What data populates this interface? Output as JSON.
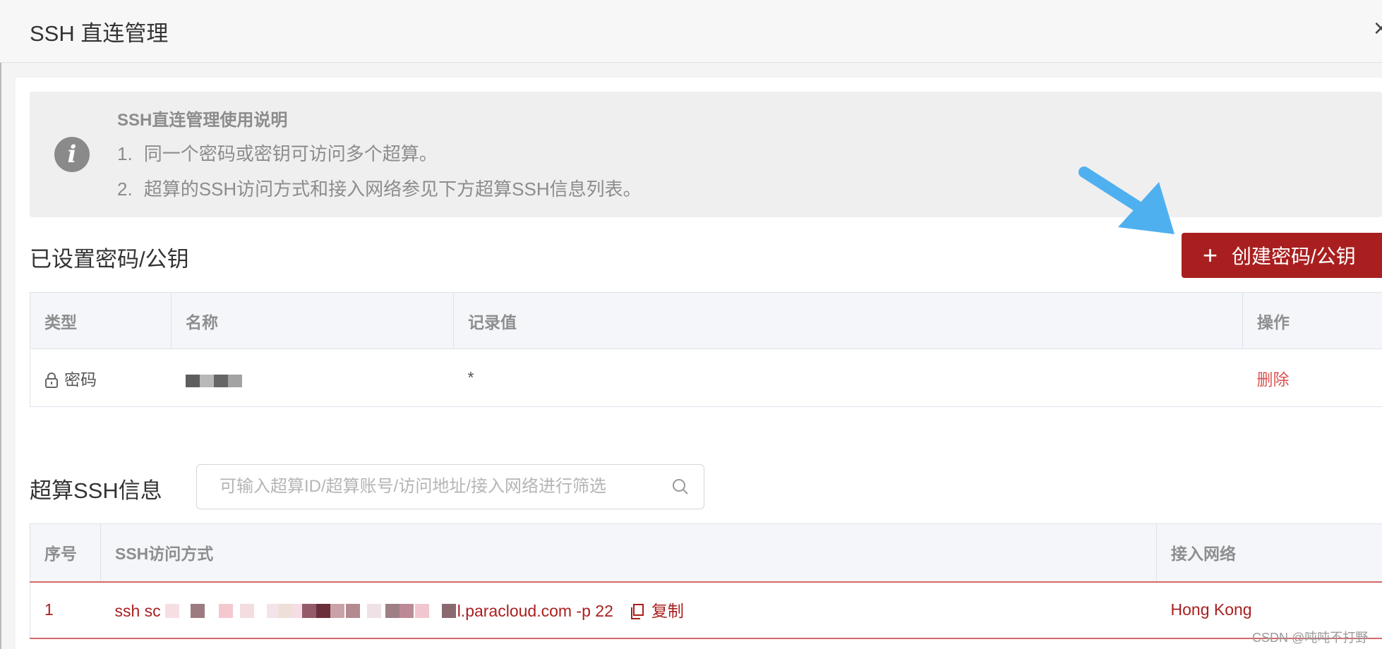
{
  "dialog": {
    "title": "SSH 直连管理",
    "close_label": "×"
  },
  "notice": {
    "title": "SSH直连管理使用说明",
    "items": [
      {
        "num": "1.",
        "text": "同一个密码或密钥可访问多个超算。"
      },
      {
        "num": "2.",
        "text": "超算的SSH访问方式和接入网络参见下方超算SSH信息列表。"
      }
    ],
    "icon": "info-icon"
  },
  "keys_section": {
    "title": "已设置密码/公钥",
    "create_button": {
      "icon": "plus-icon",
      "label": "创建密码/公钥"
    },
    "columns": [
      "类型",
      "名称",
      "记录值",
      "操作"
    ],
    "rows": [
      {
        "type": "密码",
        "type_icon": "lock-icon",
        "name": "",
        "record_value": "*",
        "action": "删除"
      }
    ]
  },
  "ssh_section": {
    "title": "超算SSH信息",
    "search": {
      "placeholder": "可输入超算ID/超算账号/访问地址/接入网络进行筛选",
      "value": ""
    },
    "columns": [
      "序号",
      "SSH访问方式",
      "接入网络"
    ],
    "rows": [
      {
        "index": "1",
        "ssh_prefix": "ssh sc",
        "ssh_suffix": "l.paracloud.com -p 22",
        "copy_label": "复制",
        "network": "Hong Kong"
      }
    ]
  },
  "colors": {
    "primary": "#a91f1f",
    "danger_link": "#d9534f",
    "annotation_arrow": "#4fb0f0"
  },
  "watermark": "CSDN @吨吨不打野"
}
